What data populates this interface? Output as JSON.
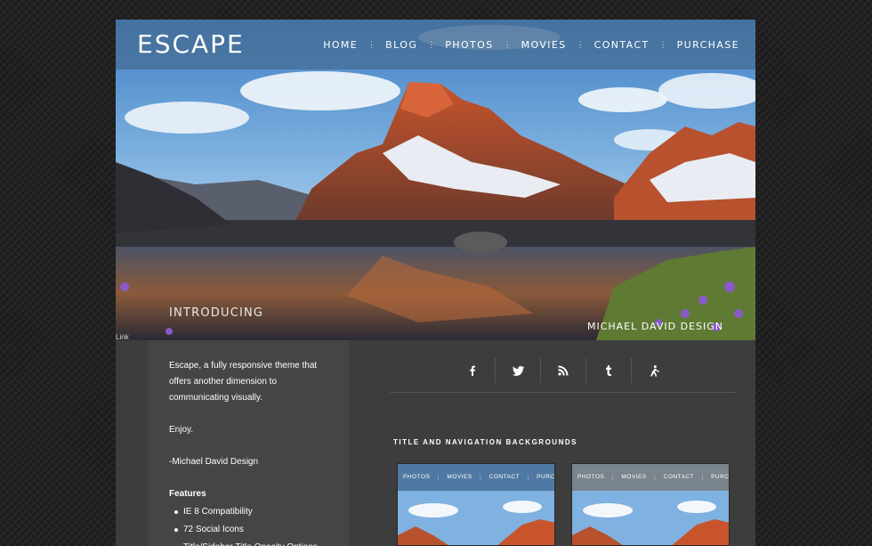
{
  "site": {
    "logo": "ESCAPE",
    "nav": [
      {
        "label": "HOME"
      },
      {
        "label": "BLOG"
      },
      {
        "label": "PHOTOS"
      },
      {
        "label": "MOVIES"
      },
      {
        "label": "CONTACT"
      },
      {
        "label": "PURCHASE"
      }
    ]
  },
  "hero": {
    "intro": "INTRODUCING",
    "credit": "MICHAEL DAVID DESIGN",
    "link": "Link"
  },
  "sidebar": {
    "intro": "Escape, a fully responsive theme that offers another dimension to communicating visually.",
    "enjoy": "Enjoy.",
    "signature": "-Michael David Design",
    "features_title": "Features",
    "features": [
      "IE 8 Compatibility",
      "72 Social Icons",
      "Title/Sidebar Title Opacity Options"
    ]
  },
  "social_icons": [
    "facebook-icon",
    "twitter-icon",
    "rss-icon",
    "tumblr-icon",
    "delicious-icon"
  ],
  "main": {
    "section_title": "TITLE AND NAVIGATION BACKGROUNDS",
    "thumbnails": [
      {
        "nav": [
          "PHOTOS",
          "MOVIES",
          "CONTACT",
          "PURCHASE"
        ]
      },
      {
        "nav": [
          "PHOTOS",
          "MOVIES",
          "CONTACT",
          "PURCHASE"
        ]
      }
    ]
  },
  "colors": {
    "page_bg": "#222222",
    "panel_bg": "#3d3d3d",
    "sidebar_bg": "#454545",
    "header_bar": "#466e96"
  }
}
